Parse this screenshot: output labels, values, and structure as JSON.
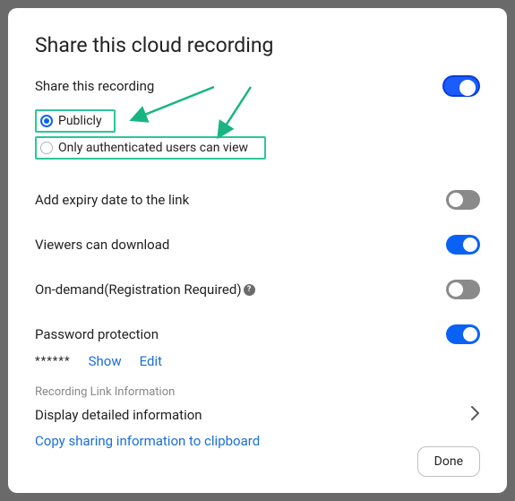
{
  "title": "Share this cloud recording",
  "share_label": "Share this recording",
  "radio_publicly": "Publicly",
  "radio_auth": "Only authenticated users can view",
  "settings": {
    "expiry": "Add expiry date to the link",
    "download": "Viewers can download",
    "ondemand": "On-demand(Registration Required)",
    "password": "Password protection"
  },
  "password_mask": "******",
  "show_label": "Show",
  "edit_label": "Edit",
  "section_label": "Recording Link Information",
  "detail_label": "Display detailed information",
  "copy_label": "Copy sharing information to clipboard",
  "done_label": "Done",
  "help_glyph": "?"
}
